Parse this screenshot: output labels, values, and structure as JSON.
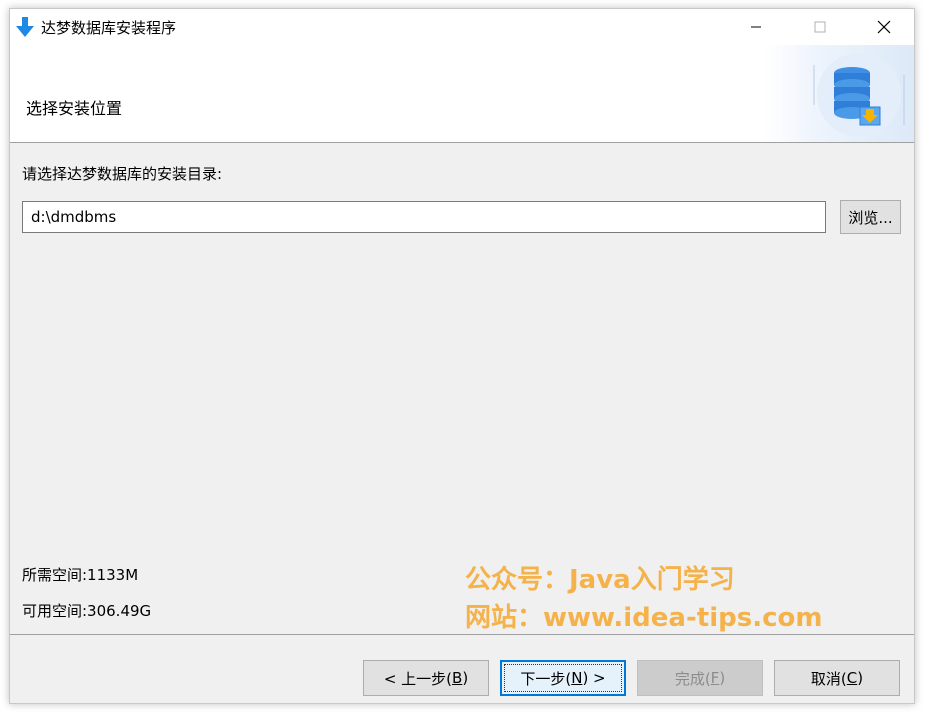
{
  "window": {
    "title": "达梦数据库安装程序",
    "icon": "download-arrow-icon",
    "accent": "#0078d7"
  },
  "header": {
    "step_title": "选择安装位置",
    "art_icon": "database-server-icon"
  },
  "main": {
    "prompt": "请选择达梦数据库的安装目录:",
    "install_path": "d:\\dmdbms",
    "browse_label": "浏览...",
    "required_space": "所需空间:1133M",
    "available_space": "可用空间:306.49G"
  },
  "watermark": {
    "line1": "公众号：Java入门学习",
    "line2": "网站：www.idea-tips.com",
    "color": "#f5b24a"
  },
  "buttons": {
    "prev": {
      "prefix": "< 上一步(",
      "key": "B",
      "suffix": ")"
    },
    "next": {
      "prefix": "下一步(",
      "key": "N",
      "suffix": ") >"
    },
    "finish": {
      "prefix": "完成(",
      "key": "F",
      "suffix": ")"
    },
    "cancel": {
      "prefix": "取消(",
      "key": "C",
      "suffix": ")"
    }
  }
}
